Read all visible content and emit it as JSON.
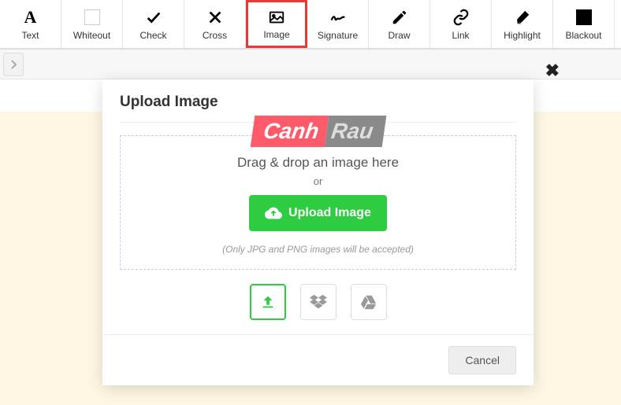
{
  "toolbar": {
    "items": [
      {
        "label": "Text"
      },
      {
        "label": "Whiteout"
      },
      {
        "label": "Check"
      },
      {
        "label": "Cross"
      },
      {
        "label": "Image"
      },
      {
        "label": "Signature"
      },
      {
        "label": "Draw"
      },
      {
        "label": "Link"
      },
      {
        "label": "Highlight"
      },
      {
        "label": "Blackout"
      }
    ]
  },
  "modal": {
    "title": "Upload Image",
    "drop_title": "Drag & drop an image here",
    "or": "or",
    "upload_button": "Upload Image",
    "accepted": "(Only JPG and PNG images will be accepted)",
    "cancel": "Cancel"
  },
  "watermark": {
    "left": "Canh",
    "right": "Rau"
  }
}
